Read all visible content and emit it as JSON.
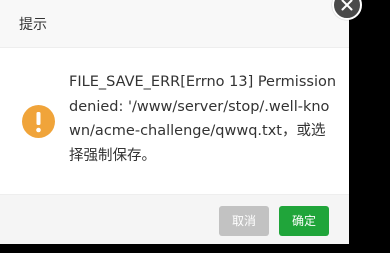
{
  "dialog": {
    "title": "提示",
    "message": "FILE_SAVE_ERR[Errno 13] Permission denied: '/www/server/stop/.well-known/acme-challenge/qwwq.txt，或选择强制保存。",
    "icon": "warning-icon",
    "cancel_label": "取消",
    "ok_label": "确定"
  },
  "colors": {
    "warning": "#f0a43a",
    "primary": "#20a53a",
    "cancel": "#c2c2c2",
    "close": "#4a4a4a"
  }
}
